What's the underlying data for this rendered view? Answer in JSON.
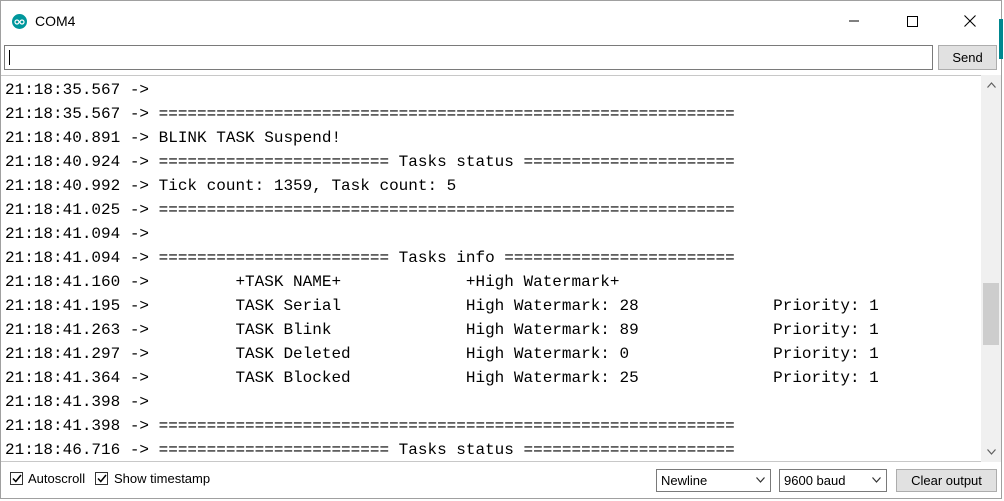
{
  "window": {
    "title": "COM4",
    "accent_color": "#00979c"
  },
  "input": {
    "value": "",
    "send_label": "Send"
  },
  "output": {
    "lines": [
      "21:18:35.567 ->",
      "21:18:35.567 -> ============================================================",
      "21:18:40.891 -> BLINK TASK Suspend!",
      "21:18:40.924 -> ======================== Tasks status ======================",
      "21:18:40.992 -> Tick count: 1359, Task count: 5",
      "21:18:41.025 -> ============================================================",
      "21:18:41.094 ->",
      "21:18:41.094 -> ======================== Tasks info ========================",
      "21:18:41.160 ->         +TASK NAME+             +High Watermark+",
      "21:18:41.195 ->         TASK Serial             High Watermark: 28              Priority: 1",
      "21:18:41.263 ->         TASK Blink              High Watermark: 89              Priority: 1",
      "21:18:41.297 ->         TASK Deleted            High Watermark: 0               Priority: 1",
      "21:18:41.364 ->         TASK Blocked            High Watermark: 25              Priority: 1",
      "21:18:41.398 ->",
      "21:18:41.398 -> ============================================================",
      "21:18:46.716 -> ======================== Tasks status ======================"
    ]
  },
  "footer": {
    "autoscroll_label": "Autoscroll",
    "autoscroll_checked": true,
    "timestamp_label": "Show timestamp",
    "timestamp_checked": true,
    "line_ending": "Newline",
    "baud_rate": "9600 baud",
    "clear_label": "Clear output"
  }
}
